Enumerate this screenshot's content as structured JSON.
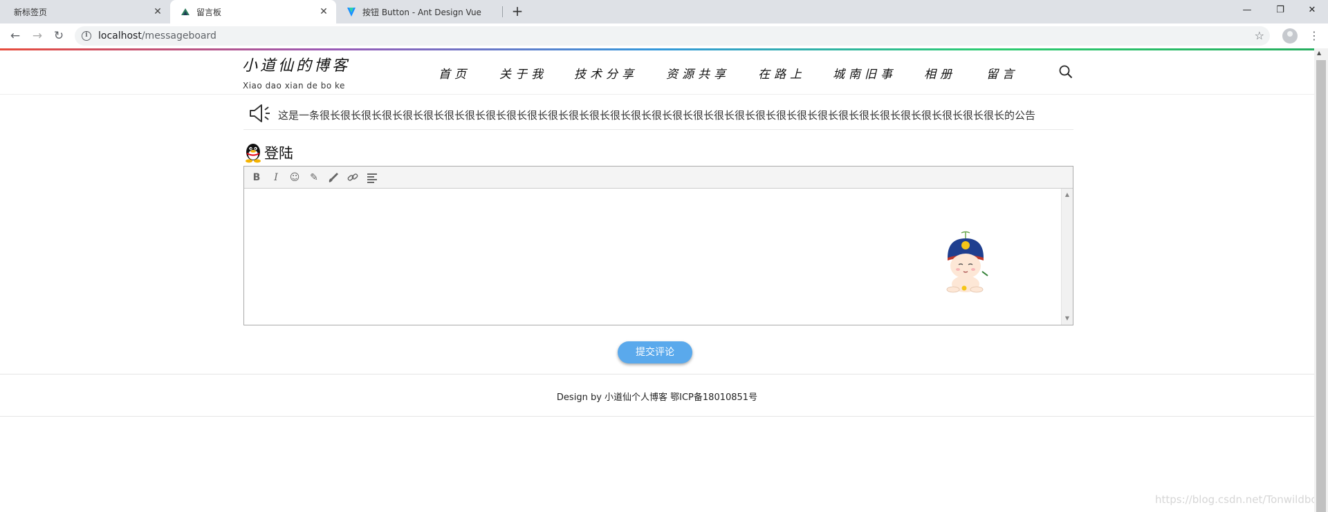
{
  "browser": {
    "tabs": [
      {
        "title": "新标签页",
        "close": "✕"
      },
      {
        "title": "留言板",
        "close": "✕"
      },
      {
        "title": "按钮 Button - Ant Design Vue",
        "close": "✕"
      }
    ],
    "new_tab": "+",
    "window_controls": {
      "minimize": "—",
      "restore": "❐",
      "close": "✕"
    },
    "nav": {
      "back": "←",
      "forward": "→",
      "reload": "↻"
    },
    "url_host": "localhost",
    "url_path": "/messageboard",
    "info_glyph": "i",
    "star_glyph": "☆",
    "menu_glyph": "⋮"
  },
  "site": {
    "logo_title": "小道仙的博客",
    "logo_subtitle": "Xiao dao xian de bo ke",
    "nav_items": [
      "首页",
      "关于我",
      "技术分享",
      "资源共享",
      "在路上",
      "城南旧事",
      "相册",
      "留言"
    ],
    "accent_gradient": [
      "#e74c3c",
      "#9b59b6",
      "#3498db",
      "#2ecc71"
    ]
  },
  "notice": {
    "text": "这是一条很长很长很长很长很长很长很长很长很长很长很长很长很长很长很长很长很长很长很长很长很长很长很长很长很长很长很长很长很长很长很长很长很长的公告"
  },
  "login": {
    "label": "登陆"
  },
  "editor": {
    "toolbar": {
      "bold": "B",
      "italic": "I",
      "emoji": "☺",
      "highlight": "✎",
      "brush": "🖌",
      "link": "🔗",
      "align": "≡"
    },
    "scroll_up": "▲",
    "scroll_down": "▼"
  },
  "submit": {
    "label": "提交评论",
    "color": "#5aa9ec"
  },
  "footer": {
    "text": "Design by 小道仙个人博客 鄂ICP备18010851号"
  },
  "watermark": "https://blog.csdn.net/Tonwildbos"
}
